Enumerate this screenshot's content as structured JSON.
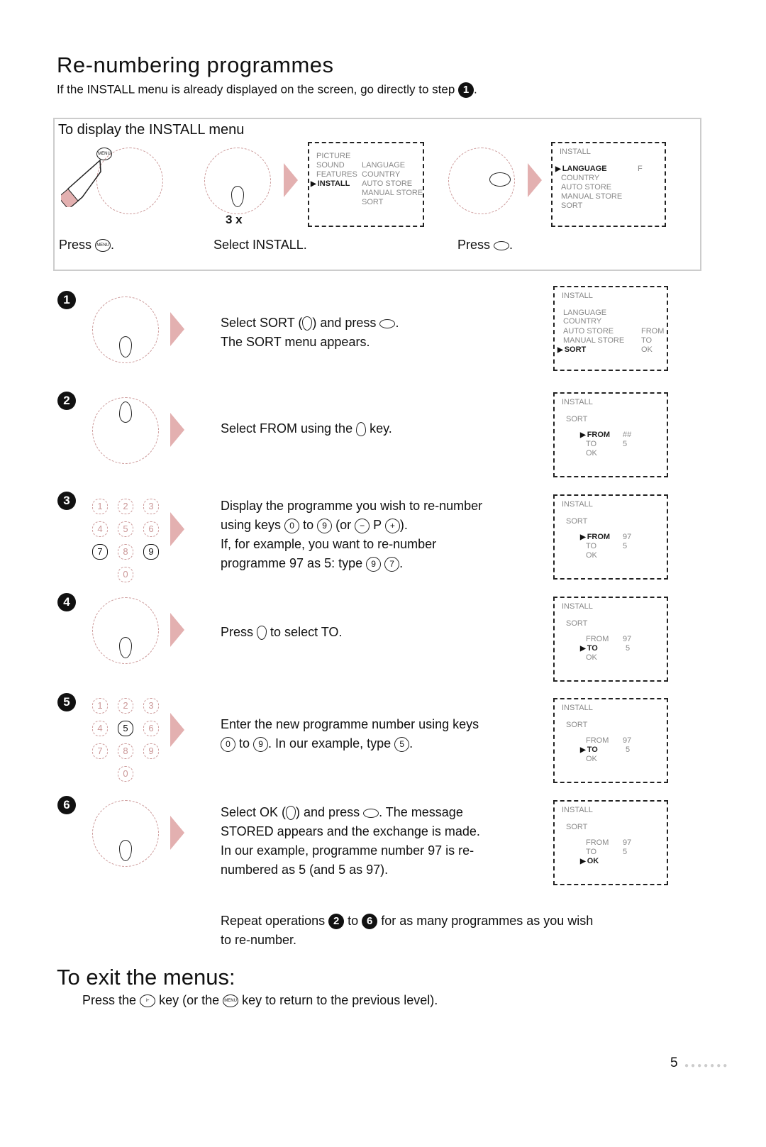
{
  "header": {
    "title": "Re-numbering programmes",
    "subtitle_pre": "If the INSTALL menu is already displayed on the screen, go directly to step",
    "subtitle_step": "1",
    "subtitle_post": "."
  },
  "install_box": {
    "title": "To display the INSTALL menu",
    "captions": {
      "press_menu": "Press",
      "select_install": "Select INSTALL.",
      "press_right": "Press"
    },
    "menu_key_label": "MENU",
    "times_label": "3 x",
    "main_menu": {
      "left_items": [
        "PICTURE",
        "SOUND",
        "FEATURES",
        "INSTALL"
      ],
      "right_items": [
        "LANGUAGE",
        "COUNTRY",
        "AUTO STORE",
        "MANUAL STORE",
        "SORT"
      ]
    },
    "install_menu": {
      "header": "INSTALL",
      "items": [
        "LANGUAGE",
        "COUNTRY",
        "AUTO STORE",
        "MANUAL STORE",
        "SORT"
      ],
      "language_value": "F"
    }
  },
  "steps": [
    {
      "number": "1",
      "lines": [
        "Select SORT (",
        ") and press",
        ".",
        "The SORT menu appears."
      ],
      "osd": {
        "header": "INSTALL",
        "items": [
          "LANGUAGE",
          "COUNTRY",
          "AUTO STORE",
          "MANUAL STORE",
          "SORT"
        ],
        "sub_items": [
          "FROM",
          "TO",
          "OK"
        ]
      }
    },
    {
      "number": "2",
      "text_pre": "Select FROM using the",
      "text_post": "key.",
      "osd": {
        "header": "INSTALL",
        "sub": "SORT",
        "rows": [
          [
            "FROM",
            "##"
          ],
          [
            "TO",
            "5"
          ],
          [
            "OK",
            ""
          ]
        ],
        "selected": "FROM"
      }
    },
    {
      "number": "3",
      "line1": "Display the programme you wish to re-number",
      "line2_pre": "using keys",
      "key0": "0",
      "to": "to",
      "key9": "9",
      "line2_or": "(or",
      "p_label": "P",
      "line2_end": ").",
      "line3": "If, for example, you want to re-number",
      "line4": "programme 97 as 5: type",
      "keys_example": [
        "9",
        "7"
      ],
      "keypad": [
        "1",
        "2",
        "3",
        "4",
        "5",
        "6",
        "7",
        "8",
        "9",
        "0"
      ],
      "osd": {
        "header": "INSTALL",
        "sub": "SORT",
        "rows": [
          [
            "FROM",
            "97"
          ],
          [
            "TO",
            "5"
          ],
          [
            "OK",
            ""
          ]
        ],
        "selected": "FROM"
      }
    },
    {
      "number": "4",
      "text_pre": "Press",
      "text_post": "to select TO.",
      "osd": {
        "header": "INSTALL",
        "sub": "SORT",
        "rows": [
          [
            "FROM",
            "97"
          ],
          [
            "TO",
            "5"
          ],
          [
            "OK",
            ""
          ]
        ],
        "selected": "TO"
      }
    },
    {
      "number": "5",
      "line1": "Enter the new programme number using keys",
      "line2_to": "to",
      "line2_mid": ". In our example, type",
      "key0": "0",
      "key9": "9",
      "key5": "5",
      "keypad": [
        "1",
        "2",
        "3",
        "4",
        "5",
        "6",
        "7",
        "8",
        "9",
        "0"
      ],
      "osd": {
        "header": "INSTALL",
        "sub": "SORT",
        "rows": [
          [
            "FROM",
            "97"
          ],
          [
            "TO",
            "5"
          ],
          [
            "OK",
            ""
          ]
        ],
        "selected": "TO"
      }
    },
    {
      "number": "6",
      "line1_pre": "Select OK (",
      "line1_mid": ") and press",
      "line1_post": ". The message",
      "line2": "STORED appears and the exchange is made.",
      "line3": "In our example, programme number 97 is re-",
      "line4": "numbered as 5 (and 5 as 97).",
      "osd": {
        "header": "INSTALL",
        "sub": "SORT",
        "rows": [
          [
            "FROM",
            "97"
          ],
          [
            "TO",
            "5"
          ],
          [
            "OK",
            ""
          ]
        ],
        "selected": "OK"
      }
    }
  ],
  "repeat": {
    "pre": "Repeat operations",
    "from": "2",
    "to": "to",
    "until": "6",
    "post": "for as many programmes as you wish",
    "line2": "to re-number."
  },
  "exit": {
    "title": "To exit the menus:",
    "pre": "Press the",
    "key1": "i+",
    "mid": "key (or the",
    "key2": "MENU",
    "post": "key to return to the previous level)."
  },
  "footer": {
    "page_number": "5",
    "dots": "●●●●●●●"
  }
}
